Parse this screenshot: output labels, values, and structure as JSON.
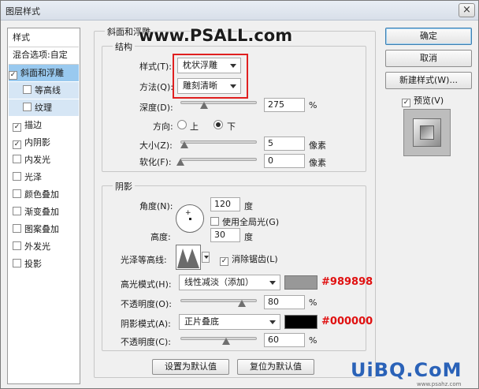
{
  "window": {
    "title": "图层样式",
    "close": "×"
  },
  "watermark_top": "www.PSALL.com",
  "watermark_bottom": {
    "logo": "UiBQ.CoM",
    "url": "www.psahz.com"
  },
  "style_list": {
    "header": "样式",
    "blend": "混合选项:自定",
    "items": [
      {
        "label": "斜面和浮雕",
        "checked": true,
        "selected": true
      },
      {
        "label": "等高线",
        "checked": false,
        "sub": true
      },
      {
        "label": "纹理",
        "checked": false,
        "sub": true
      },
      {
        "label": "描边",
        "checked": true
      },
      {
        "label": "内阴影",
        "checked": true
      },
      {
        "label": "内发光",
        "checked": false
      },
      {
        "label": "光泽",
        "checked": false
      },
      {
        "label": "颜色叠加",
        "checked": false
      },
      {
        "label": "渐变叠加",
        "checked": false
      },
      {
        "label": "图案叠加",
        "checked": false
      },
      {
        "label": "外发光",
        "checked": false
      },
      {
        "label": "投影",
        "checked": false
      }
    ]
  },
  "bevel": {
    "group_title": "斜面和浮雕",
    "structure_title": "结构",
    "style_label": "样式(T):",
    "style_value": "枕状浮雕",
    "method_label": "方法(Q):",
    "method_value": "雕刻清晰",
    "depth_label": "深度(D):",
    "depth_value": "275",
    "depth_unit": "%",
    "depth_level": 0.31,
    "direction_label": "方向:",
    "direction_up": "上",
    "direction_down": "下",
    "size_label": "大小(Z):",
    "size_value": "5",
    "size_unit": "像素",
    "size_level": 0.05,
    "soften_label": "软化(F):",
    "soften_value": "0",
    "soften_unit": "像素",
    "soften_level": 0.0
  },
  "shading": {
    "title": "阴影",
    "angle_label": "角度(N):",
    "angle_value": "120",
    "angle_unit": "度",
    "global_light_label": "使用全局光(G)",
    "altitude_label": "高度:",
    "altitude_value": "30",
    "altitude_unit": "度",
    "gloss_label": "光泽等高线:",
    "antialias_label": "消除锯齿(L)",
    "highlight_label": "高光模式(H):",
    "highlight_mode": "线性减淡（添加）",
    "highlight_color": "#989898",
    "highlight_hex": "#989898",
    "opacity1_label": "不透明度(O):",
    "opacity1_value": "80",
    "opacity1_unit": "%",
    "opacity1_level": 0.8,
    "shadow_label": "阴影模式(A):",
    "shadow_mode": "正片叠底",
    "shadow_color": "#000000",
    "shadow_hex": "#000000",
    "opacity2_label": "不透明度(C):",
    "opacity2_value": "60",
    "opacity2_unit": "%",
    "opacity2_level": 0.6
  },
  "buttons": {
    "ok": "确定",
    "cancel": "取消",
    "new_style": "新建样式(W)...",
    "preview": "预览(V)",
    "make_default": "设置为默认值",
    "reset_default": "复位为默认值"
  }
}
